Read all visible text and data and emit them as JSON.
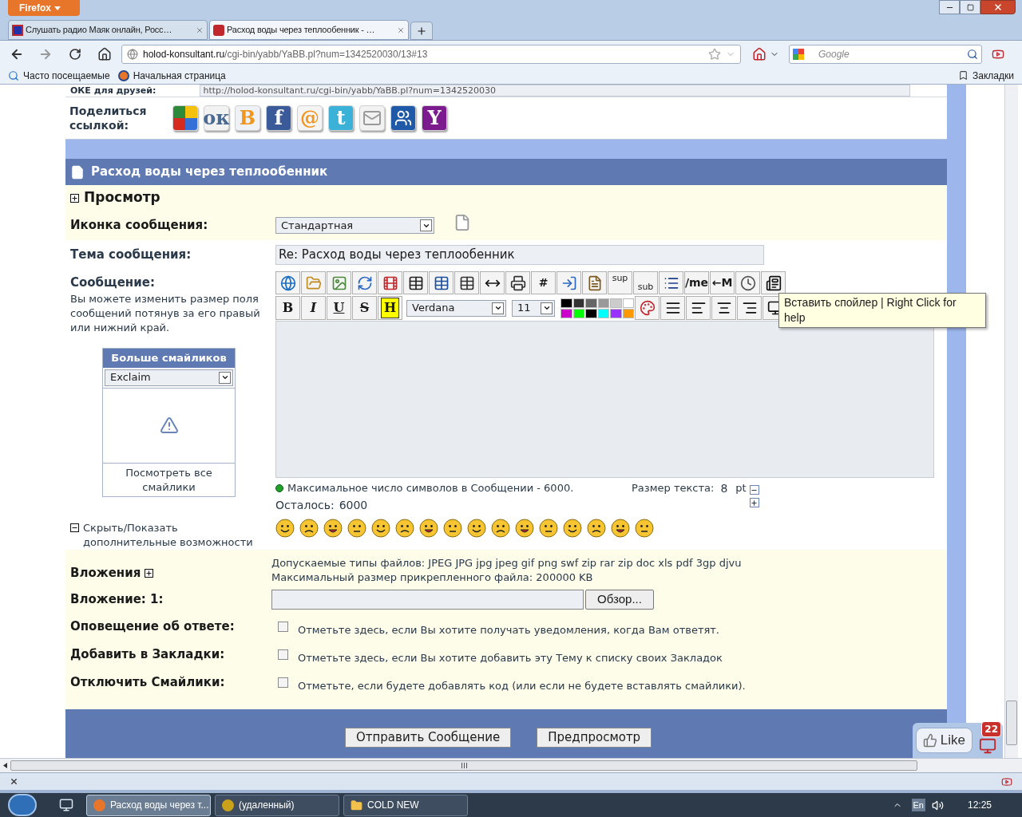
{
  "browser": {
    "menu_button": "Firefox",
    "tabs": [
      {
        "title": "Слушать радио Маяк онлайн, Росс…",
        "selected": false
      },
      {
        "title": "Расход воды через теплообенник - …",
        "selected": true
      }
    ],
    "url": {
      "host": "holod-konsultant.ru",
      "path": "/cgi-bin/yabb/YaBB.pl?num=1342520030/13#13"
    },
    "search": {
      "placeholder": "Google"
    },
    "bookmarks": [
      {
        "label": "Часто посещаемые"
      },
      {
        "label": "Начальная страница"
      }
    ],
    "bookmarks_menu": "Закладки"
  },
  "share": {
    "link_label": "ОКЕ для друзей:",
    "link_url": "http://holod-konsultant.ru/cgi-bin/yabb/YaBB.pl?num=1342520030",
    "label": "Поделиться ссылкой:",
    "buttons": [
      {
        "kind": "quad"
      },
      {
        "kind": "glyph",
        "glyph": "ок",
        "color": "#f2f2f2"
      },
      {
        "kind": "glyph",
        "glyph": "B",
        "color": "#eef1f5"
      },
      {
        "kind": "glyph",
        "glyph": "f",
        "color": "#3b5a9a"
      },
      {
        "kind": "glyph",
        "glyph": "@",
        "color": "#f4f4f4"
      },
      {
        "kind": "glyph",
        "glyph": "t",
        "color": "#3cb1d8"
      },
      {
        "kind": "mail",
        "color": "#f2f2f2"
      },
      {
        "kind": "people",
        "color": "#1f5aa8"
      },
      {
        "kind": "glyph",
        "glyph": "Y",
        "color": "#7b1b8e"
      }
    ]
  },
  "post": {
    "title": "Расход воды через теплообенник",
    "preview": {
      "label": "Просмотр",
      "expanded": false
    },
    "icon_row": {
      "label": "Иконка сообщения:",
      "value": "Стандартная"
    },
    "subject": {
      "label": "Тема сообщения:",
      "value": "Re: Расход воды через теплообенник"
    },
    "message": {
      "label": "Сообщение:",
      "hint": "Вы можете изменить размер поля сообщений потянув за его правый или нижний край."
    },
    "smiley_box": {
      "title": "Больше смайликов",
      "value": "Exclaim",
      "link": "Посмотреть все смайлики"
    },
    "toggle_more": {
      "label": "Скрыть/Показать дополнительные возможности",
      "expanded": true
    },
    "toolbar_top": [
      {
        "kind": "icon"
      },
      {
        "kind": "icon"
      },
      {
        "kind": "icon"
      },
      {
        "kind": "icon"
      },
      {
        "kind": "icon"
      },
      {
        "kind": "icon"
      },
      {
        "kind": "icon"
      },
      {
        "kind": "icon"
      },
      {
        "kind": "icon"
      },
      {
        "kind": "icon"
      },
      {
        "kind": "text",
        "label": "#"
      },
      {
        "kind": "icon"
      },
      {
        "kind": "icon"
      },
      {
        "kind": "sup",
        "label": "sup"
      },
      {
        "kind": "sub",
        "label": "sub"
      },
      {
        "kind": "icon"
      },
      {
        "kind": "text",
        "label": "/me"
      },
      {
        "kind": "text",
        "label": "←M"
      },
      {
        "kind": "icon"
      },
      {
        "kind": "icon"
      }
    ],
    "format_buttons": [
      {
        "label": "B"
      },
      {
        "label": "I"
      },
      {
        "label": "U"
      },
      {
        "label": "S"
      },
      {
        "label": "H"
      }
    ],
    "font": "Verdana",
    "size": "11",
    "palette": [
      {
        "color": "#000000"
      },
      {
        "color": "#333333"
      },
      {
        "color": "#666666"
      },
      {
        "color": "#999999"
      },
      {
        "color": "#cccccc"
      },
      {
        "color": "#ffffff"
      },
      {
        "color": "#cc00cc"
      },
      {
        "color": "#00ff00"
      },
      {
        "color": "#000000"
      },
      {
        "color": "#00ffff"
      },
      {
        "color": "#9933ff"
      },
      {
        "color": "#ff9900"
      }
    ],
    "tooltip": "Вставить спойлер | Right Click for help",
    "counter": {
      "text": "Максимальное число символов в Сообщении - 6000.",
      "size_label": "Размер текста:",
      "size": "8",
      "unit": "pt",
      "remaining_label": "Осталось:",
      "remaining": "6000"
    },
    "attachments": {
      "label": "Вложения",
      "types": "Допускаемые типы файлов: JPEG JPG jpg jpeg gif png swf zip rar zip doc xls pdf 3gp djvu",
      "max": "Максимальный размер прикрепленного файла: 200000 KB",
      "field_label": "Вложение: 1:",
      "browse": "Обзор..."
    },
    "options": [
      {
        "label": "Оповещение об ответе:",
        "text": "Отметьте здесь, если Вы хотите получать уведомления, когда Вам ответят.",
        "checked": false
      },
      {
        "label": "Добавить в Закладки:",
        "text": "Отметьте здесь, если Вы хотите добавить эту Тему к списку своих Закладок",
        "checked": false
      },
      {
        "label": "Отключить Смайлики:",
        "text": "Отметьте, если будете добавлять код (или если не будете вставлять смайлики).",
        "checked": false
      }
    ],
    "buttons": [
      "Отправить Сообщение",
      "Предпросмотр"
    ]
  },
  "like": {
    "label": "Like",
    "count": "22"
  },
  "taskbar": {
    "items": [
      {
        "label": "Расход воды через т...",
        "selected": true
      },
      {
        "label": "(удаленный)",
        "selected": false
      },
      {
        "label": "COLD NEW",
        "selected": false
      }
    ],
    "language": "En",
    "clock": "12:25"
  }
}
